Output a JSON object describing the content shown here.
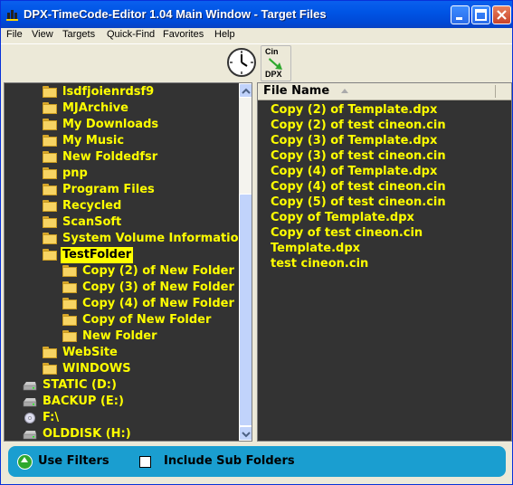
{
  "window": {
    "title": "DPX-TimeCode-Editor 1.04 Main Window - Target Files"
  },
  "menu": [
    "File",
    "View",
    "Targets",
    "Quick-Find",
    "Favorites",
    "Help"
  ],
  "toolbar": {
    "cin_label": "Cin",
    "dpx_label": "DPX"
  },
  "tree": [
    {
      "label": "lsdfjoienrdsf9",
      "type": "folder",
      "depth": 1
    },
    {
      "label": "MJArchive",
      "type": "folder",
      "depth": 1
    },
    {
      "label": "My Downloads",
      "type": "folder",
      "depth": 1
    },
    {
      "label": "My Music",
      "type": "folder",
      "depth": 1
    },
    {
      "label": "New Foldedfsr",
      "type": "folder",
      "depth": 1
    },
    {
      "label": "pnp",
      "type": "folder",
      "depth": 1
    },
    {
      "label": "Program Files",
      "type": "folder",
      "depth": 1
    },
    {
      "label": "Recycled",
      "type": "folder",
      "depth": 1
    },
    {
      "label": "ScanSoft",
      "type": "folder",
      "depth": 1
    },
    {
      "label": "System Volume Information",
      "type": "folder",
      "depth": 1
    },
    {
      "label": "TestFolder",
      "type": "folder",
      "depth": 1,
      "selected": true
    },
    {
      "label": "Copy (2) of New Folder",
      "type": "folder",
      "depth": 2
    },
    {
      "label": "Copy (3) of New Folder",
      "type": "folder",
      "depth": 2
    },
    {
      "label": "Copy (4) of New Folder",
      "type": "folder",
      "depth": 2
    },
    {
      "label": "Copy of New Folder",
      "type": "folder",
      "depth": 2
    },
    {
      "label": "New Folder",
      "type": "folder",
      "depth": 2
    },
    {
      "label": "WebSite",
      "type": "folder",
      "depth": 1
    },
    {
      "label": "WINDOWS",
      "type": "folder",
      "depth": 1
    },
    {
      "label": "STATIC (D:)",
      "type": "drive",
      "depth": 0
    },
    {
      "label": "BACKUP (E:)",
      "type": "drive",
      "depth": 0
    },
    {
      "label": "F:\\",
      "type": "cdrom",
      "depth": 0
    },
    {
      "label": "OLDDISK (H:)",
      "type": "drive",
      "depth": 0
    }
  ],
  "files": {
    "column_header": "File Name",
    "items": [
      "Copy (2) of Template.dpx",
      "Copy (2) of test cineon.cin",
      "Copy (3) of Template.dpx",
      "Copy (3) of test cineon.cin",
      "Copy (4) of Template.dpx",
      "Copy (4) of test cineon.cin",
      "Copy (5) of test cineon.cin",
      "Copy of Template.dpx",
      "Copy of test cineon.cin",
      "Template.dpx",
      "test cineon.cin"
    ]
  },
  "bottom": {
    "use_filters": "Use Filters",
    "include_sub_folders": "Include Sub Folders",
    "include_sub_folders_checked": false
  },
  "colors": {
    "pane_bg": "#333333",
    "text": "#FFFF00",
    "titlebar": "#0055E5",
    "bottom_bar": "#1A9ED0"
  }
}
